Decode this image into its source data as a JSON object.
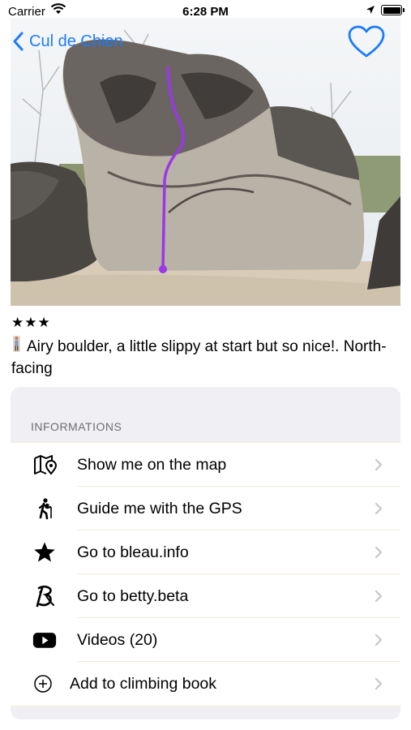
{
  "status_bar": {
    "carrier": "Carrier",
    "time": "6:28 PM"
  },
  "nav": {
    "back_label": "Cul de Chien",
    "accent_color": "#1a7bff"
  },
  "problem": {
    "rating": "★★★",
    "description": "Airy boulder, a little slippy at start but so nice!. North-facing",
    "route_color": "#9b37e6"
  },
  "informations": {
    "section_title": "INFORMATIONS",
    "items": [
      {
        "label": "Show me on the map",
        "icon": "map-pin-icon"
      },
      {
        "label": "Guide me with the GPS",
        "icon": "hiker-icon"
      },
      {
        "label": "Go to bleau.info",
        "icon": "star-icon"
      },
      {
        "label": "Go to betty.beta",
        "icon": "betty-logo-icon"
      },
      {
        "label": "Videos (20)",
        "icon": "youtube-icon"
      },
      {
        "label": "Add to climbing book",
        "icon": "plus-circle-icon"
      }
    ]
  }
}
